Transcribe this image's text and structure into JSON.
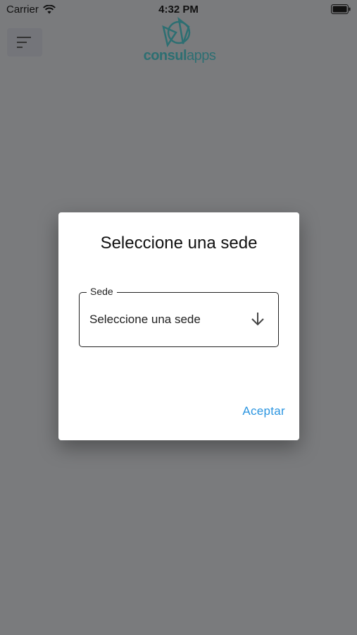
{
  "status_bar": {
    "carrier": "Carrier",
    "time": "4:32 PM",
    "wifi_icon": "wifi-icon",
    "battery_icon": "battery-icon"
  },
  "header": {
    "menu_icon": "hamburger-menu-icon",
    "logo": {
      "text_a": "consul",
      "text_b": "apps"
    }
  },
  "dialog": {
    "title": "Seleccione una sede",
    "field": {
      "label": "Sede",
      "value": "Seleccione una sede",
      "icon": "arrow-down-icon"
    },
    "accept_label": "Aceptar"
  },
  "colors": {
    "overlay": "#7a7b7d",
    "accent": "#2b95e0",
    "brand": "#2d6f72"
  }
}
